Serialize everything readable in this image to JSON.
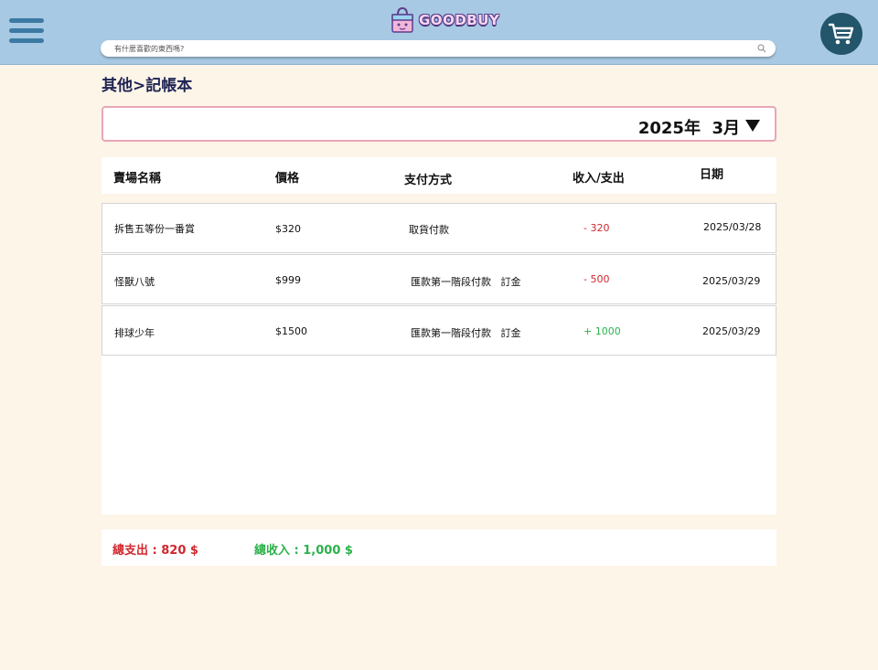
{
  "header": {
    "logo_text": "GOODBUY",
    "search_placeholder": "有什麼喜歡的東西嗎?"
  },
  "breadcrumb": "其他>記帳本",
  "date_filter": {
    "value": "2025年  3月"
  },
  "table": {
    "columns": [
      "賣場名稱",
      "價格",
      "支付方式",
      "收入/支出",
      "日期"
    ],
    "rows": [
      {
        "store": "拆售五等份一番賞",
        "price": "$320",
        "payment": "取貨付款",
        "amount": "- 320",
        "date": "2025/03/28"
      },
      {
        "store": "怪獸八號",
        "price": "$999",
        "payment": "匯款第一階段付款   訂金",
        "amount": "- 500",
        "date": "2025/03/29"
      },
      {
        "store": "排球少年",
        "price": "$1500",
        "payment": "匯款第一階段付款   訂金",
        "amount": "+ 1000",
        "date": "2025/03/29"
      }
    ]
  },
  "summary": {
    "total_expense": "總支出 : 820 $",
    "total_income": "總收入 : 1,000 $"
  },
  "colors": {
    "header_bg": "#a8c9e4",
    "page_bg": "#fdf5e8",
    "expense": "#d0282e",
    "income": "#2bb24a",
    "cart_bg": "#23556b"
  }
}
